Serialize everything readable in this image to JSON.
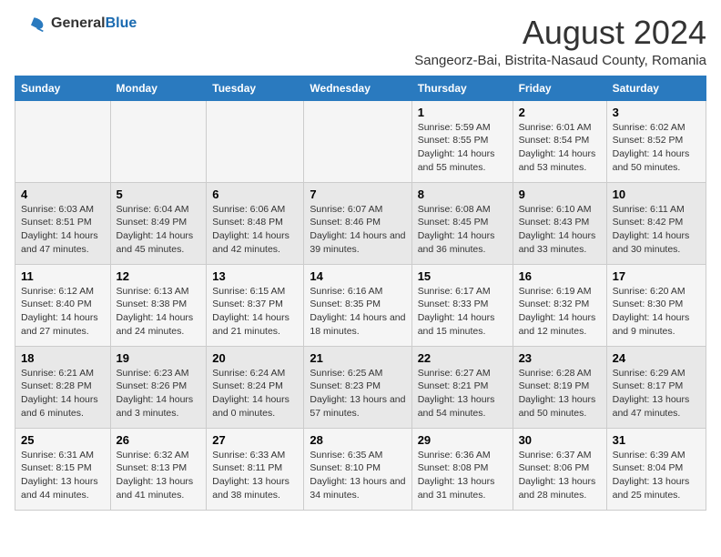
{
  "logo": {
    "general": "General",
    "blue": "Blue"
  },
  "title": "August 2024",
  "subtitle": "Sangeorz-Bai, Bistrita-Nasaud County, Romania",
  "days_header": [
    "Sunday",
    "Monday",
    "Tuesday",
    "Wednesday",
    "Thursday",
    "Friday",
    "Saturday"
  ],
  "weeks": [
    [
      {
        "day": "",
        "info": ""
      },
      {
        "day": "",
        "info": ""
      },
      {
        "day": "",
        "info": ""
      },
      {
        "day": "",
        "info": ""
      },
      {
        "day": "1",
        "info": "Sunrise: 5:59 AM\nSunset: 8:55 PM\nDaylight: 14 hours and 55 minutes."
      },
      {
        "day": "2",
        "info": "Sunrise: 6:01 AM\nSunset: 8:54 PM\nDaylight: 14 hours and 53 minutes."
      },
      {
        "day": "3",
        "info": "Sunrise: 6:02 AM\nSunset: 8:52 PM\nDaylight: 14 hours and 50 minutes."
      }
    ],
    [
      {
        "day": "4",
        "info": "Sunrise: 6:03 AM\nSunset: 8:51 PM\nDaylight: 14 hours and 47 minutes."
      },
      {
        "day": "5",
        "info": "Sunrise: 6:04 AM\nSunset: 8:49 PM\nDaylight: 14 hours and 45 minutes."
      },
      {
        "day": "6",
        "info": "Sunrise: 6:06 AM\nSunset: 8:48 PM\nDaylight: 14 hours and 42 minutes."
      },
      {
        "day": "7",
        "info": "Sunrise: 6:07 AM\nSunset: 8:46 PM\nDaylight: 14 hours and 39 minutes."
      },
      {
        "day": "8",
        "info": "Sunrise: 6:08 AM\nSunset: 8:45 PM\nDaylight: 14 hours and 36 minutes."
      },
      {
        "day": "9",
        "info": "Sunrise: 6:10 AM\nSunset: 8:43 PM\nDaylight: 14 hours and 33 minutes."
      },
      {
        "day": "10",
        "info": "Sunrise: 6:11 AM\nSunset: 8:42 PM\nDaylight: 14 hours and 30 minutes."
      }
    ],
    [
      {
        "day": "11",
        "info": "Sunrise: 6:12 AM\nSunset: 8:40 PM\nDaylight: 14 hours and 27 minutes."
      },
      {
        "day": "12",
        "info": "Sunrise: 6:13 AM\nSunset: 8:38 PM\nDaylight: 14 hours and 24 minutes."
      },
      {
        "day": "13",
        "info": "Sunrise: 6:15 AM\nSunset: 8:37 PM\nDaylight: 14 hours and 21 minutes."
      },
      {
        "day": "14",
        "info": "Sunrise: 6:16 AM\nSunset: 8:35 PM\nDaylight: 14 hours and 18 minutes."
      },
      {
        "day": "15",
        "info": "Sunrise: 6:17 AM\nSunset: 8:33 PM\nDaylight: 14 hours and 15 minutes."
      },
      {
        "day": "16",
        "info": "Sunrise: 6:19 AM\nSunset: 8:32 PM\nDaylight: 14 hours and 12 minutes."
      },
      {
        "day": "17",
        "info": "Sunrise: 6:20 AM\nSunset: 8:30 PM\nDaylight: 14 hours and 9 minutes."
      }
    ],
    [
      {
        "day": "18",
        "info": "Sunrise: 6:21 AM\nSunset: 8:28 PM\nDaylight: 14 hours and 6 minutes."
      },
      {
        "day": "19",
        "info": "Sunrise: 6:23 AM\nSunset: 8:26 PM\nDaylight: 14 hours and 3 minutes."
      },
      {
        "day": "20",
        "info": "Sunrise: 6:24 AM\nSunset: 8:24 PM\nDaylight: 14 hours and 0 minutes."
      },
      {
        "day": "21",
        "info": "Sunrise: 6:25 AM\nSunset: 8:23 PM\nDaylight: 13 hours and 57 minutes."
      },
      {
        "day": "22",
        "info": "Sunrise: 6:27 AM\nSunset: 8:21 PM\nDaylight: 13 hours and 54 minutes."
      },
      {
        "day": "23",
        "info": "Sunrise: 6:28 AM\nSunset: 8:19 PM\nDaylight: 13 hours and 50 minutes."
      },
      {
        "day": "24",
        "info": "Sunrise: 6:29 AM\nSunset: 8:17 PM\nDaylight: 13 hours and 47 minutes."
      }
    ],
    [
      {
        "day": "25",
        "info": "Sunrise: 6:31 AM\nSunset: 8:15 PM\nDaylight: 13 hours and 44 minutes."
      },
      {
        "day": "26",
        "info": "Sunrise: 6:32 AM\nSunset: 8:13 PM\nDaylight: 13 hours and 41 minutes."
      },
      {
        "day": "27",
        "info": "Sunrise: 6:33 AM\nSunset: 8:11 PM\nDaylight: 13 hours and 38 minutes."
      },
      {
        "day": "28",
        "info": "Sunrise: 6:35 AM\nSunset: 8:10 PM\nDaylight: 13 hours and 34 minutes."
      },
      {
        "day": "29",
        "info": "Sunrise: 6:36 AM\nSunset: 8:08 PM\nDaylight: 13 hours and 31 minutes."
      },
      {
        "day": "30",
        "info": "Sunrise: 6:37 AM\nSunset: 8:06 PM\nDaylight: 13 hours and 28 minutes."
      },
      {
        "day": "31",
        "info": "Sunrise: 6:39 AM\nSunset: 8:04 PM\nDaylight: 13 hours and 25 minutes."
      }
    ]
  ]
}
